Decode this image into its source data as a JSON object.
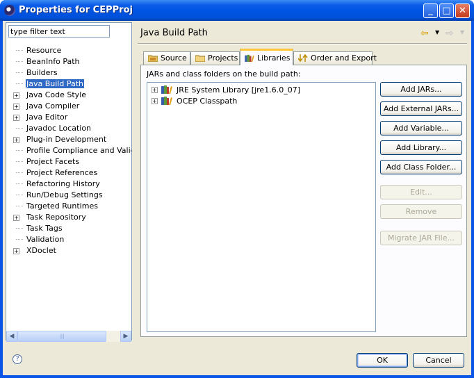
{
  "window": {
    "title": "Properties for CEPProj",
    "minimize_glyph": "_",
    "maximize_glyph": "□",
    "close_glyph": "✕"
  },
  "filter": {
    "placeholder": "type filter text",
    "value": "type filter text"
  },
  "tree": {
    "items": [
      {
        "label": "Resource",
        "expandable": false,
        "selected": false
      },
      {
        "label": "BeanInfo Path",
        "expandable": false,
        "selected": false
      },
      {
        "label": "Builders",
        "expandable": false,
        "selected": false
      },
      {
        "label": "Java Build Path",
        "expandable": false,
        "selected": true
      },
      {
        "label": "Java Code Style",
        "expandable": true,
        "selected": false
      },
      {
        "label": "Java Compiler",
        "expandable": true,
        "selected": false
      },
      {
        "label": "Java Editor",
        "expandable": true,
        "selected": false
      },
      {
        "label": "Javadoc Location",
        "expandable": false,
        "selected": false
      },
      {
        "label": "Plug-in Development",
        "expandable": true,
        "selected": false
      },
      {
        "label": "Profile Compliance and Validatic",
        "expandable": false,
        "selected": false
      },
      {
        "label": "Project Facets",
        "expandable": false,
        "selected": false
      },
      {
        "label": "Project References",
        "expandable": false,
        "selected": false
      },
      {
        "label": "Refactoring History",
        "expandable": false,
        "selected": false
      },
      {
        "label": "Run/Debug Settings",
        "expandable": false,
        "selected": false
      },
      {
        "label": "Targeted Runtimes",
        "expandable": false,
        "selected": false
      },
      {
        "label": "Task Repository",
        "expandable": true,
        "selected": false
      },
      {
        "label": "Task Tags",
        "expandable": false,
        "selected": false
      },
      {
        "label": "Validation",
        "expandable": false,
        "selected": false
      },
      {
        "label": "XDoclet",
        "expandable": true,
        "selected": false
      }
    ]
  },
  "page": {
    "title": "Java Build Path"
  },
  "tabs": [
    {
      "label": "Source",
      "icon": "source-folder-icon",
      "active": false
    },
    {
      "label": "Projects",
      "icon": "project-folder-icon",
      "active": false
    },
    {
      "label": "Libraries",
      "icon": "library-books-icon",
      "active": true
    },
    {
      "label": "Order and Export",
      "icon": "order-export-icon",
      "active": false
    }
  ],
  "libraries": {
    "caption": "JARs and class folders on the build path:",
    "items": [
      {
        "label": "JRE System Library [jre1.6.0_07]",
        "icon": "library-books-icon"
      },
      {
        "label": "OCEP Classpath",
        "icon": "library-books-icon"
      }
    ]
  },
  "buttons": [
    {
      "label": "Add JARs...",
      "enabled": true
    },
    {
      "label": "Add External JARs...",
      "enabled": true
    },
    {
      "label": "Add Variable...",
      "enabled": true
    },
    {
      "label": "Add Library...",
      "enabled": true
    },
    {
      "label": "Add Class Folder...",
      "enabled": true
    },
    {
      "label": "Edit...",
      "enabled": false
    },
    {
      "label": "Remove",
      "enabled": false
    },
    {
      "label": "Migrate JAR File...",
      "enabled": false
    }
  ],
  "footer": {
    "help_glyph": "?",
    "ok_label": "OK",
    "cancel_label": "Cancel"
  },
  "colors": {
    "titlebar": "#0054e3",
    "selection": "#316ac5",
    "active_tab_accent": "#ffc83c",
    "dialog_bg": "#ece9d8"
  }
}
